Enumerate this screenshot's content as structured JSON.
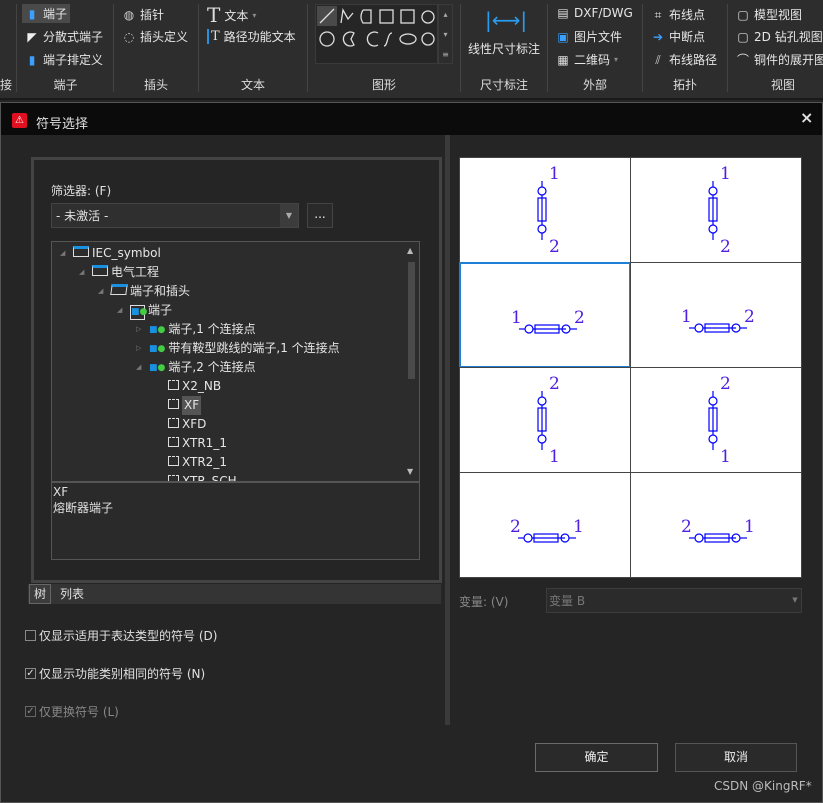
{
  "ribbon": {
    "groups": [
      {
        "label": "接",
        "items": []
      },
      {
        "label": "端子",
        "items": [
          "端子",
          "分散式端子",
          "端子排定义"
        ]
      },
      {
        "label": "插头",
        "items": [
          "插针",
          "插头定义"
        ]
      },
      {
        "label": "文本",
        "items": [
          "文本",
          "路径功能文本"
        ]
      },
      {
        "label": "图形",
        "items": []
      },
      {
        "label": "尺寸标注",
        "items": [
          "线性尺寸标注"
        ]
      },
      {
        "label": "外部",
        "items": [
          "DXF/DWG",
          "图片文件",
          "二维码"
        ]
      },
      {
        "label": "拓扑",
        "items": [
          "布线点",
          "中断点",
          "布线路径"
        ]
      },
      {
        "label": "视图",
        "items": [
          "模型视图",
          "2D 钻孔视图",
          "铜件的展开图"
        ]
      }
    ]
  },
  "dialog": {
    "title": "符号选择",
    "close": "×",
    "filter_label": "筛选器: (F)",
    "filter_value": "- 未激活 -",
    "more_button": "...",
    "tree": [
      {
        "label": "IEC_symbol",
        "level": 0,
        "icon": "folder-icon"
      },
      {
        "label": "电气工程",
        "level": 1,
        "icon": "folder-icon"
      },
      {
        "label": "端子和插头",
        "level": 2,
        "icon": "folder-open-icon"
      },
      {
        "label": "端子",
        "level": 3,
        "icon": "symbol-library-icon"
      },
      {
        "label": "端子,1 个连接点",
        "level": 4,
        "icon": "symbol-group-icon"
      },
      {
        "label": "带有鞍型跳线的端子,1 个连接点",
        "level": 4,
        "icon": "symbol-group-icon"
      },
      {
        "label": "端子,2 个连接点",
        "level": 4,
        "icon": "symbol-group-icon"
      },
      {
        "label": "X2_NB",
        "level": 5,
        "icon": "terminal-icon"
      },
      {
        "label": "XF",
        "level": 5,
        "icon": "terminal-icon",
        "selected": true
      },
      {
        "label": "XFD",
        "level": 5,
        "icon": "terminal-icon"
      },
      {
        "label": "XTR1_1",
        "level": 5,
        "icon": "terminal-icon"
      },
      {
        "label": "XTR2_1",
        "level": 5,
        "icon": "terminal-icon"
      },
      {
        "label": "XTR_SCH",
        "level": 5,
        "icon": "terminal-icon"
      }
    ],
    "description": {
      "name": "XF",
      "text": "熔断器端子"
    },
    "tabs": [
      "树",
      "列表"
    ],
    "checkboxes": [
      {
        "label": "仅显示适用于表达类型的符号 (D)",
        "checked": false,
        "enabled": true
      },
      {
        "label": "仅显示功能类别相同的符号 (N)",
        "checked": true,
        "enabled": true
      },
      {
        "label": "仅更换符号 (L)",
        "checked": true,
        "enabled": false
      }
    ],
    "preview": {
      "selected_index": 2,
      "cells": [
        {
          "orientation": "vertical",
          "labels": [
            "1",
            "2"
          ]
        },
        {
          "orientation": "vertical",
          "labels": [
            "1",
            "2"
          ]
        },
        {
          "orientation": "horizontal",
          "labels": [
            "1",
            "2"
          ]
        },
        {
          "orientation": "horizontal",
          "labels": [
            "1",
            "2"
          ]
        },
        {
          "orientation": "vertical",
          "labels": [
            "2",
            "1"
          ]
        },
        {
          "orientation": "vertical",
          "labels": [
            "2",
            "1"
          ]
        },
        {
          "orientation": "horizontal",
          "labels": [
            "2",
            "1"
          ]
        },
        {
          "orientation": "horizontal",
          "labels": [
            "2",
            "1"
          ]
        }
      ],
      "symbol_color": "#0000ff",
      "label_color": "#5020e0"
    },
    "variant_label": "变量: (V)",
    "variant_value": "变量 B",
    "ok": "确定",
    "cancel": "取消",
    "watermark": "CSDN @KingRF*"
  }
}
